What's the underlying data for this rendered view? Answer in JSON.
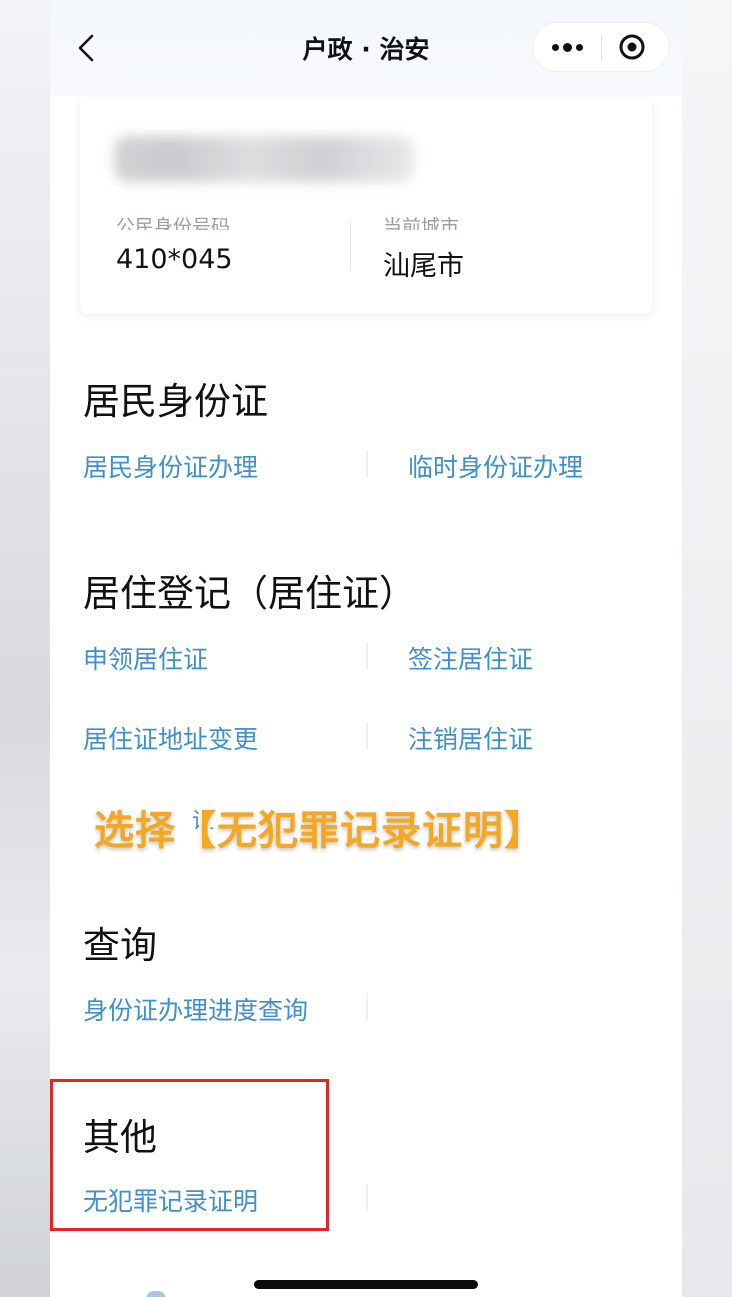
{
  "navbar": {
    "title": "户政 · 治安"
  },
  "user_card": {
    "id_label": "公民身份号码",
    "id_value": "410*045",
    "city_label": "当前城市",
    "city_value": "汕尾市"
  },
  "sections": {
    "id_card": {
      "title": "居民身份证",
      "links": [
        "居民身份证办理",
        "临时身份证办理"
      ]
    },
    "residence": {
      "title": "居住登记（居住证）",
      "links": [
        "申领居住证",
        "签注居住证",
        "居住证地址变更",
        "注销居住证",
        "证"
      ]
    },
    "query": {
      "title": "查询",
      "links": [
        "身份证办理进度查询"
      ]
    },
    "other": {
      "title": "其他",
      "links": [
        "无犯罪记录证明"
      ]
    }
  },
  "overlay": {
    "instruction": "选择【无犯罪记录证明】"
  },
  "colors": {
    "link": "#3f8fd0",
    "overlay_text": "#f5a81f",
    "highlight_box": "#e62424"
  }
}
